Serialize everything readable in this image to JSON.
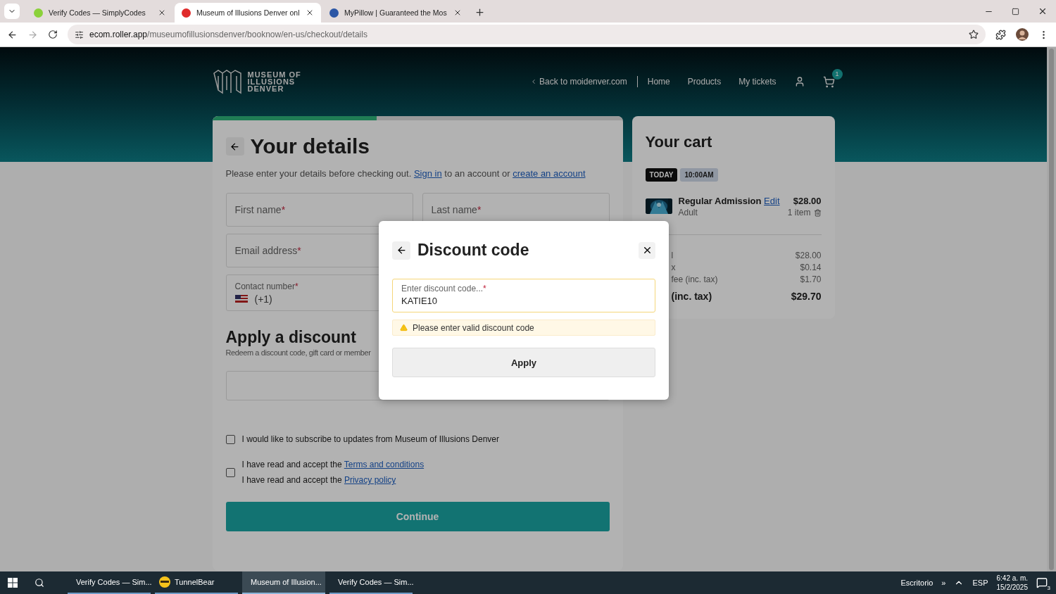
{
  "browser": {
    "tabs": [
      {
        "title": "Verify Codes — SimplyCodes",
        "selected": false
      },
      {
        "title": "Museum of Illusions Denver onl",
        "selected": true
      },
      {
        "title": "MyPillow | Guaranteed the Mos",
        "selected": false
      }
    ],
    "url": {
      "host": "ecom.roller.app",
      "path": "/museumofillusionsdenver/booknow/en-us/checkout/details"
    }
  },
  "site": {
    "logo": [
      "MUSEUM OF",
      "ILLUSIONS",
      "DENVER"
    ],
    "back_link": "Back to moidenver.com",
    "links": [
      "Home",
      "Products",
      "My tickets"
    ],
    "cart_count": "1"
  },
  "details": {
    "progress": {
      "level": 0.4
    },
    "title": "Your details",
    "intro": "Please enter your details before checking out.",
    "sign_in": "Sign in",
    "middle": "to an account or",
    "create": "create an account",
    "fields": [
      {
        "label": "First name",
        "required": "*"
      },
      {
        "label": "Last name",
        "required": "*"
      },
      {
        "label": "Email address",
        "required": "*"
      }
    ],
    "contact": {
      "label": "Contact number",
      "required": "*",
      "code": "(+1)"
    },
    "discount": {
      "title": "Apply a discount",
      "subtitle": "Redeem a discount code, gift card or member"
    },
    "consents": [
      {
        "checked": false,
        "lines": [
          {
            "text": "I would like to subscribe to updates from Museum of Illusions Denver"
          }
        ]
      },
      {
        "checked": false,
        "lines": [
          {
            "text": "I have read and accept the",
            "link": "Terms and conditions"
          },
          {
            "text": "I have read and accept the",
            "link": "Privacy policy"
          }
        ]
      }
    ],
    "continue": "Continue"
  },
  "cart": {
    "title": "Your cart",
    "date": "TODAY",
    "time": "10:00AM",
    "item": {
      "name": "Regular Admission",
      "edit": "Edit",
      "variant": "Adult",
      "price": "$28.00",
      "qty": "1 item"
    },
    "summary": [
      {
        "label": "l",
        "value": "$28.00",
        "kind": "line"
      },
      {
        "label": "x",
        "value": "$0.14",
        "kind": "line"
      },
      {
        "label": "fee (inc. tax)",
        "value": "$1.70",
        "kind": "line"
      },
      {
        "label": "(inc. tax)",
        "value": "$29.70",
        "kind": "total"
      }
    ]
  },
  "modal": {
    "title": "Discount code",
    "field": {
      "placeholder": "Enter discount code...",
      "required": "*",
      "value": "KATIE10"
    },
    "warning": "Please enter valid discount code",
    "apply": "Apply"
  },
  "taskbar": {
    "apps": [
      {
        "label": "Verify Codes — Sim...",
        "kind": "chrome",
        "selected": false
      },
      {
        "label": "TunnelBear",
        "kind": "bear",
        "selected": false
      },
      {
        "label": "Museum of Illusion...",
        "kind": "chrome",
        "selected": true
      },
      {
        "label": "Verify Codes — Sim...",
        "kind": "chrome",
        "selected": false
      }
    ],
    "desktop": "Escritorio",
    "more": "»",
    "lang": "ESP",
    "time": "6:42 a. m.",
    "date": "15/2/2025",
    "notifications": "3"
  }
}
